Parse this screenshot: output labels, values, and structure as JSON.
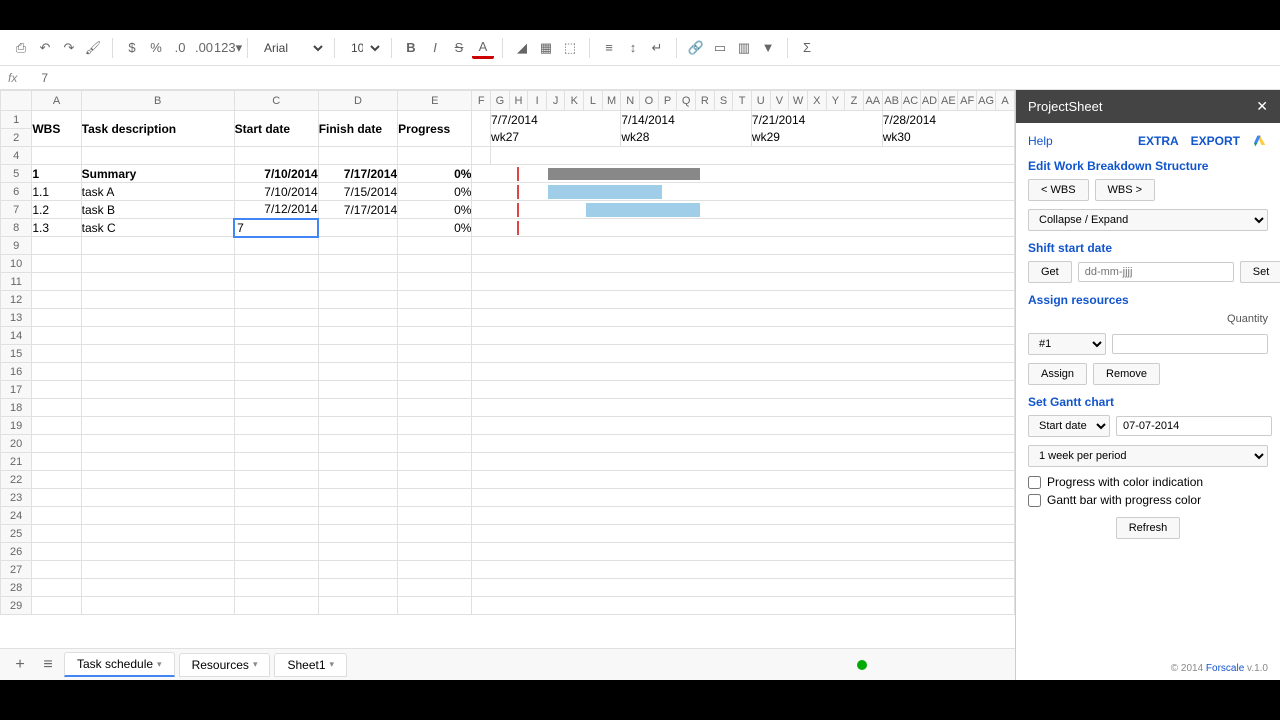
{
  "formula_bar": {
    "label": "fx",
    "value": "7"
  },
  "toolbar": {
    "font": "Arial",
    "size": "10"
  },
  "columns": {
    "main": [
      "A",
      "B",
      "C",
      "D",
      "E"
    ],
    "narrow": [
      "F",
      "G",
      "H",
      "I",
      "J",
      "K",
      "L",
      "M",
      "N",
      "O",
      "P",
      "Q",
      "R",
      "S",
      "T",
      "U",
      "V",
      "W",
      "X",
      "Y",
      "Z",
      "AA",
      "AB",
      "AC",
      "AD",
      "AE",
      "AF",
      "AG",
      "A"
    ]
  },
  "headers": {
    "wbs": "WBS",
    "task": "Task description",
    "start": "Start date",
    "finish": "Finish date",
    "progress": "Progress"
  },
  "weeks": [
    {
      "date": "7/7/2014",
      "wk": "wk27"
    },
    {
      "date": "7/14/2014",
      "wk": "wk28"
    },
    {
      "date": "7/21/2014",
      "wk": "wk29"
    },
    {
      "date": "7/28/2014",
      "wk": "wk30"
    }
  ],
  "rows": [
    {
      "n": 5,
      "wbs": "1",
      "task": "Summary",
      "start": "7/10/2014",
      "finish": "7/17/2014",
      "prog": "0%",
      "bold": true
    },
    {
      "n": 6,
      "wbs": "1.1",
      "task": "task A",
      "start": "7/10/2014",
      "finish": "7/15/2014",
      "prog": "0%"
    },
    {
      "n": 7,
      "wbs": "1.2",
      "task": "task B",
      "start": "7/12/2014",
      "finish": "7/17/2014",
      "prog": "0%"
    },
    {
      "n": 8,
      "wbs": "1.3",
      "task": "task C",
      "start": "",
      "finish": "",
      "prog": "0%",
      "editing": "7"
    }
  ],
  "sidebar": {
    "title": "ProjectSheet",
    "help": "Help",
    "extra": "EXTRA",
    "export": "EXPORT",
    "edit_wbs": "Edit Work Breakdown Structure",
    "wbs_left": "< WBS",
    "wbs_right": "WBS >",
    "collapse": "Collapse / Expand",
    "shift": "Shift start date",
    "get": "Get",
    "date_ph": "dd-mm-jjjj",
    "set": "Set",
    "assign": "Assign resources",
    "qty": "Quantity",
    "resource_sel": "#1",
    "assign_btn": "Assign",
    "remove_btn": "Remove",
    "gantt": "Set Gantt chart",
    "startdate_lbl": "Start date",
    "startdate_val": "07-07-2014",
    "period": "1 week per period",
    "chk_progress": "Progress with color indication",
    "chk_bar": "Gantt bar with progress color",
    "refresh": "Refresh",
    "copyright": "© 2014 ",
    "forscale": "Forscale",
    "version": " v.1.0"
  },
  "tabs": {
    "schedule": "Task schedule",
    "resources": "Resources",
    "sheet1": "Sheet1"
  }
}
